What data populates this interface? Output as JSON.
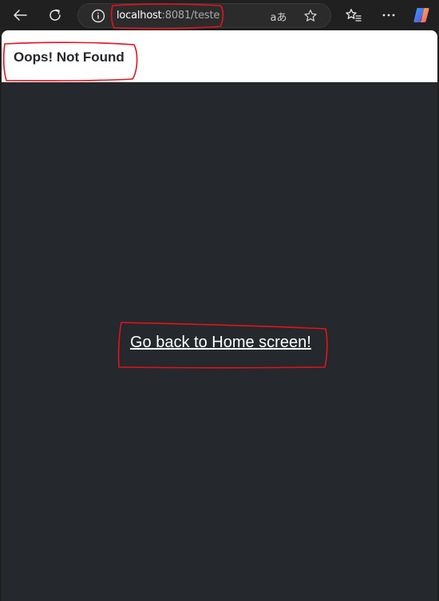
{
  "browser": {
    "url_host": "localhost",
    "url_rest": ":8081/teste",
    "read_aloud_glyph": "aあ",
    "icons": [
      "back-icon",
      "refresh-icon",
      "info-icon",
      "read-aloud-icon",
      "favorite-star-icon",
      "favorites-icon",
      "more-icon",
      "copilot-icon"
    ]
  },
  "page": {
    "title": "Oops! Not Found",
    "home_link": "Go back to Home screen!"
  },
  "colors": {
    "chrome_bg": "#202020",
    "page_bg": "#25282c",
    "header_bg": "#ffffff",
    "annotation": "#e0141e"
  }
}
